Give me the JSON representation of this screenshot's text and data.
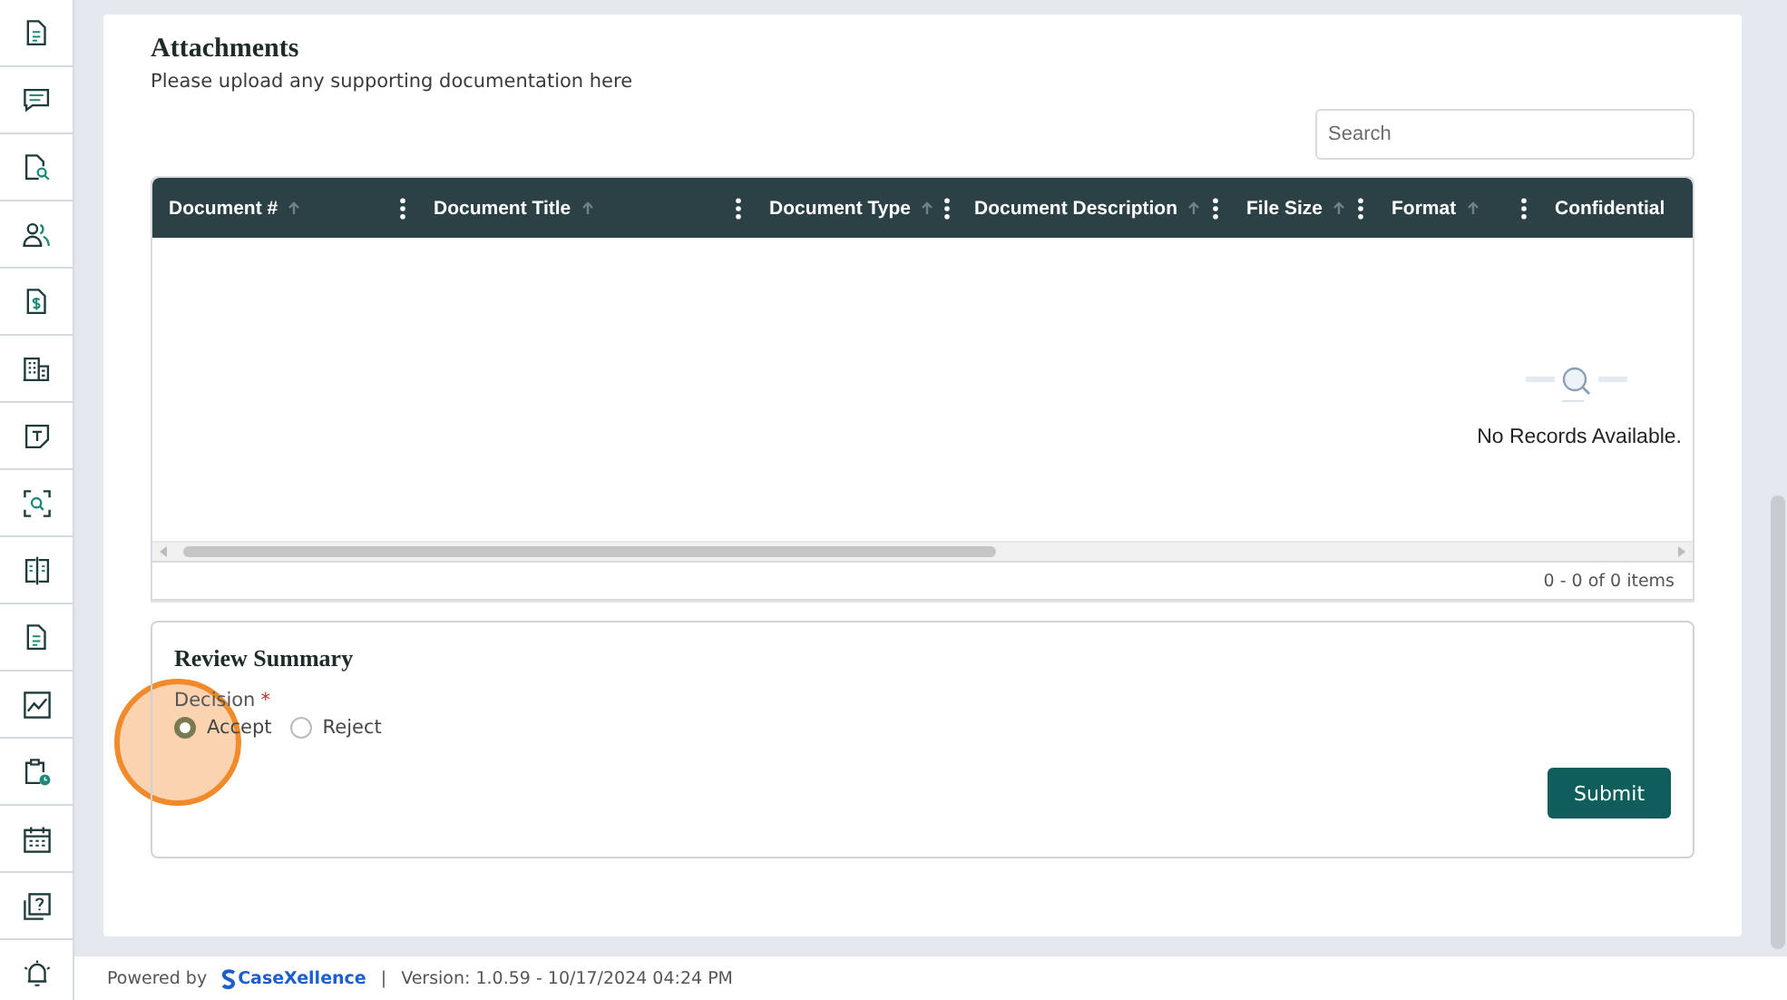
{
  "sidebar": {
    "items": [
      {
        "kind": "document"
      },
      {
        "kind": "chat"
      },
      {
        "kind": "file-search"
      },
      {
        "kind": "people"
      },
      {
        "kind": "invoice"
      },
      {
        "kind": "building"
      },
      {
        "kind": "text-note"
      },
      {
        "kind": "scan"
      },
      {
        "kind": "compare"
      },
      {
        "kind": "document"
      },
      {
        "kind": "chart"
      },
      {
        "kind": "clipboard-clock"
      },
      {
        "kind": "calendar"
      },
      {
        "kind": "help"
      },
      {
        "kind": "alarm"
      }
    ]
  },
  "attachments": {
    "title": "Attachments",
    "subtitle": "Please upload any supporting documentation here",
    "search": {
      "placeholder": "Search"
    },
    "table": {
      "columns": [
        {
          "label": "Document #",
          "sort_icon": true,
          "menu": true
        },
        {
          "label": "Document Title",
          "sort_icon": true,
          "menu": true
        },
        {
          "label": "Document Type",
          "sort_icon": true,
          "menu": true
        },
        {
          "label": "Document Description",
          "sort_icon": true,
          "menu": true
        },
        {
          "label": "File Size",
          "sort_icon": true,
          "menu": true
        },
        {
          "label": "Format",
          "sort_icon": true,
          "menu": true
        },
        {
          "label": "Confidential",
          "sort_icon": false,
          "menu": false
        }
      ],
      "empty_message": "No Records Available.",
      "pager": "0 - 0 of 0 items"
    }
  },
  "review_summary": {
    "title": "Review Summary",
    "decision": {
      "label": "Decision",
      "required_mark": "*",
      "options": [
        {
          "label": "Accept",
          "selected": true
        },
        {
          "label": "Reject",
          "selected": false
        }
      ]
    },
    "submit": "Submit"
  },
  "click_indicator": {
    "visible": true
  },
  "footer": {
    "powered_by": "Powered by",
    "brand": "CaseXellence",
    "separator": "|",
    "version": "Version: 1.0.59 - 10/17/2024 04:24 PM"
  }
}
